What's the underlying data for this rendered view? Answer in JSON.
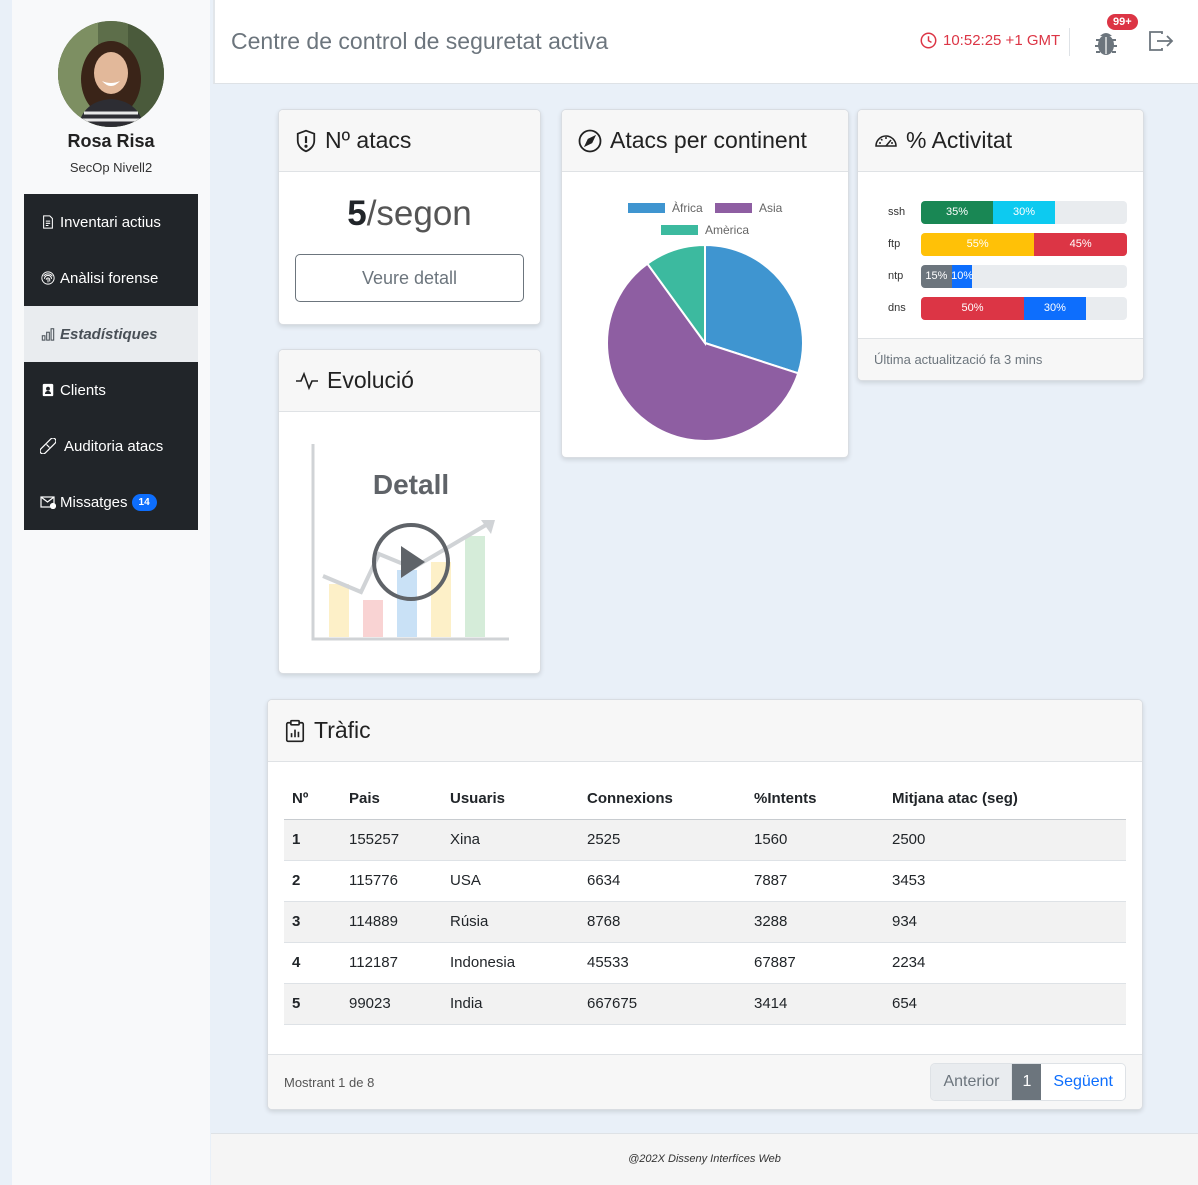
{
  "user": {
    "name": "Rosa Risa",
    "role": "SecOp Nivell2"
  },
  "menu": [
    {
      "label": "Inventari actius",
      "icon": "document-icon"
    },
    {
      "label": "Anàlisi forense",
      "icon": "fingerprint-icon"
    },
    {
      "label": "Estadístiques",
      "icon": "bar-chart-icon",
      "active": true
    },
    {
      "label": "Clients",
      "icon": "contact-icon"
    },
    {
      "label": "Auditoria atacs",
      "icon": "bandage-icon"
    },
    {
      "label": "Missatges",
      "icon": "envelope-icon",
      "badge": "14"
    }
  ],
  "header": {
    "title": "Centre de control de seguretat activa",
    "time": "10:52:25 +1 GMT",
    "notifications_badge": "99+"
  },
  "cards": {
    "atacs": {
      "title": "Nº atacs",
      "value": "5",
      "unit": "/segon",
      "button": "Veure detall"
    },
    "evolucio": {
      "title": "Evolució",
      "overlay_text": "Detall"
    },
    "continent": {
      "title": "Atacs per continent"
    },
    "activitat": {
      "title": "% Activitat",
      "rows": [
        {
          "label": "ssh",
          "segments": [
            {
              "text": "35%",
              "value": 35,
              "color": "#198754"
            },
            {
              "text": "30%",
              "value": 30,
              "color": "#0dcaf0"
            }
          ]
        },
        {
          "label": "ftp",
          "segments": [
            {
              "text": "55%",
              "value": 55,
              "color": "#ffc107"
            },
            {
              "text": "45%",
              "value": 45,
              "color": "#dc3545"
            }
          ]
        },
        {
          "label": "ntp",
          "segments": [
            {
              "text": "15%",
              "value": 15,
              "color": "#6c757d"
            },
            {
              "text": "10%",
              "value": 10,
              "color": "#0d6efd"
            }
          ]
        },
        {
          "label": "dns",
          "segments": [
            {
              "text": "50%",
              "value": 50,
              "color": "#dc3545"
            },
            {
              "text": "30%",
              "value": 30,
              "color": "#0d6efd"
            }
          ]
        }
      ],
      "footer": "Última actualització fa 3 mins"
    }
  },
  "chart_data": {
    "type": "pie",
    "categories": [
      "Àfrica",
      "Asia",
      "Amèrica"
    ],
    "values": [
      30,
      60,
      10
    ],
    "colors": [
      "#3f95d0",
      "#8e5ea2",
      "#3cba9f"
    ],
    "legend": "top"
  },
  "traffic": {
    "title": "Tràfic",
    "columns": [
      "Nº",
      "Pais",
      "Usuaris",
      "Connexions",
      "%Intents",
      "Mitjana atac (seg)"
    ],
    "rows": [
      [
        "1",
        "155257",
        "Xina",
        "2525",
        "1560",
        "2500"
      ],
      [
        "2",
        "115776",
        "USA",
        "6634",
        "7887",
        "3453"
      ],
      [
        "3",
        "114889",
        "Rúsia",
        "8768",
        "3288",
        "934"
      ],
      [
        "4",
        "112187",
        "Indonesia",
        "45533",
        "67887",
        "2234"
      ],
      [
        "5",
        "99023",
        "India",
        "667675",
        "3414",
        "654"
      ]
    ],
    "showing": "Mostrant 1 de 8",
    "pager": {
      "prev": "Anterior",
      "current": "1",
      "next": "Següent"
    }
  },
  "footer": "@202X Disseny Interfíces Web"
}
